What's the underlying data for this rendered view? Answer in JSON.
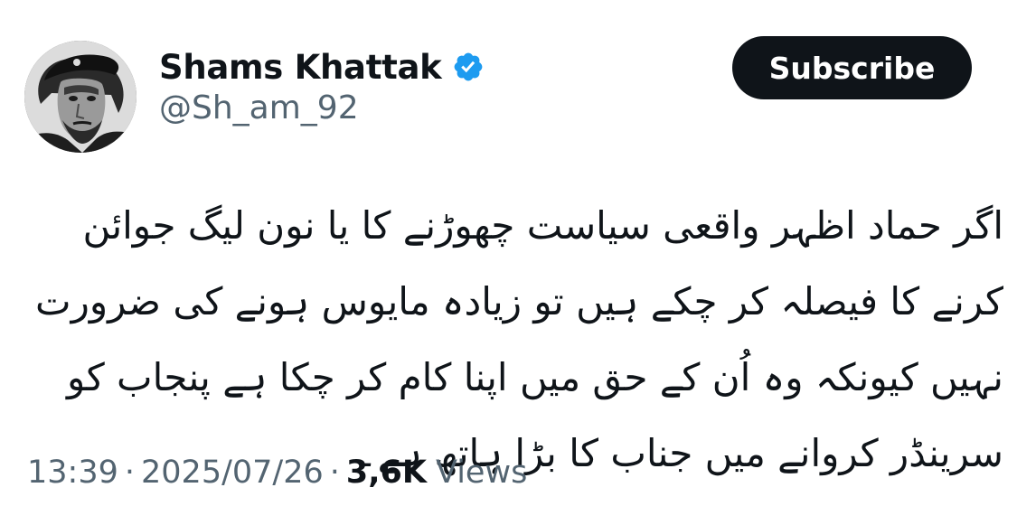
{
  "author": {
    "display_name": "Shams Khattak",
    "handle": "@Sh_am_92",
    "verified": true,
    "verified_color": "#1d9bf0"
  },
  "subscribe_button": {
    "label": "Subscribe"
  },
  "tweet": {
    "text": "اگر حماد اظہر واقعی سیاست چھوڑنے کا یا نون لیگ جوائن کرنے کا فیصلہ کر چکے ہیں تو زیادہ مایوس ہونے کی ضرورت نہیں کیونکہ وہ اُن کے حق میں اپنا کام کر چکا ہے پنجاب کو سرینڈر کروانے میں جناب کا بڑا ہاتھ ہے۔"
  },
  "meta": {
    "time": "13:39",
    "separator": "·",
    "date": "2025/07/26",
    "views_count": "3,6K",
    "views_label": "Views"
  },
  "colors": {
    "text_primary": "#0f1419",
    "text_secondary": "#536471",
    "button_bg": "#0f1419",
    "button_text": "#ffffff",
    "background": "#ffffff"
  },
  "icons": {
    "verified": "verified-badge-icon",
    "avatar": "profile-photo"
  }
}
